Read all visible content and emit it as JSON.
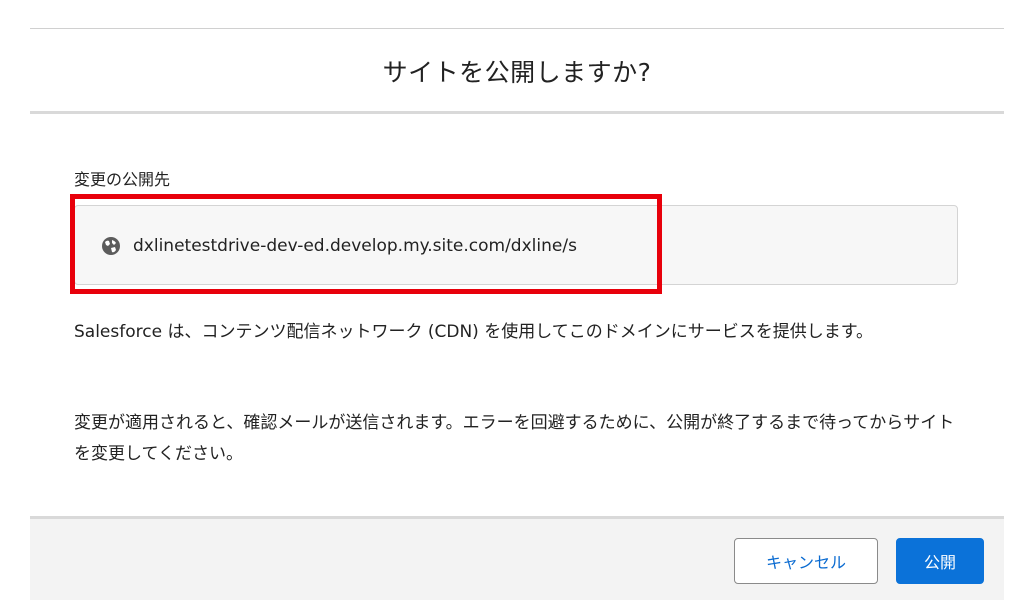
{
  "dialog": {
    "title": "サイトを公開しますか?",
    "section_label": "変更の公開先",
    "url": "dxlinetestdrive-dev-ed.develop.my.site.com/dxline/s",
    "url_icon": "globe-icon",
    "paragraph_1": "Salesforce は、コンテンツ配信ネットワーク (CDN) を使用してこのドメインにサービスを提供します。",
    "paragraph_2": "変更が適用されると、確認メールが送信されます。エラーを回避するために、公開が終了するまで待ってからサイトを変更してください。"
  },
  "footer": {
    "cancel_label": "キャンセル",
    "publish_label": "公開"
  },
  "colors": {
    "brand_button": "#0b72d9",
    "highlight": "#e8000b",
    "footer_bg": "#f3f3f3"
  }
}
